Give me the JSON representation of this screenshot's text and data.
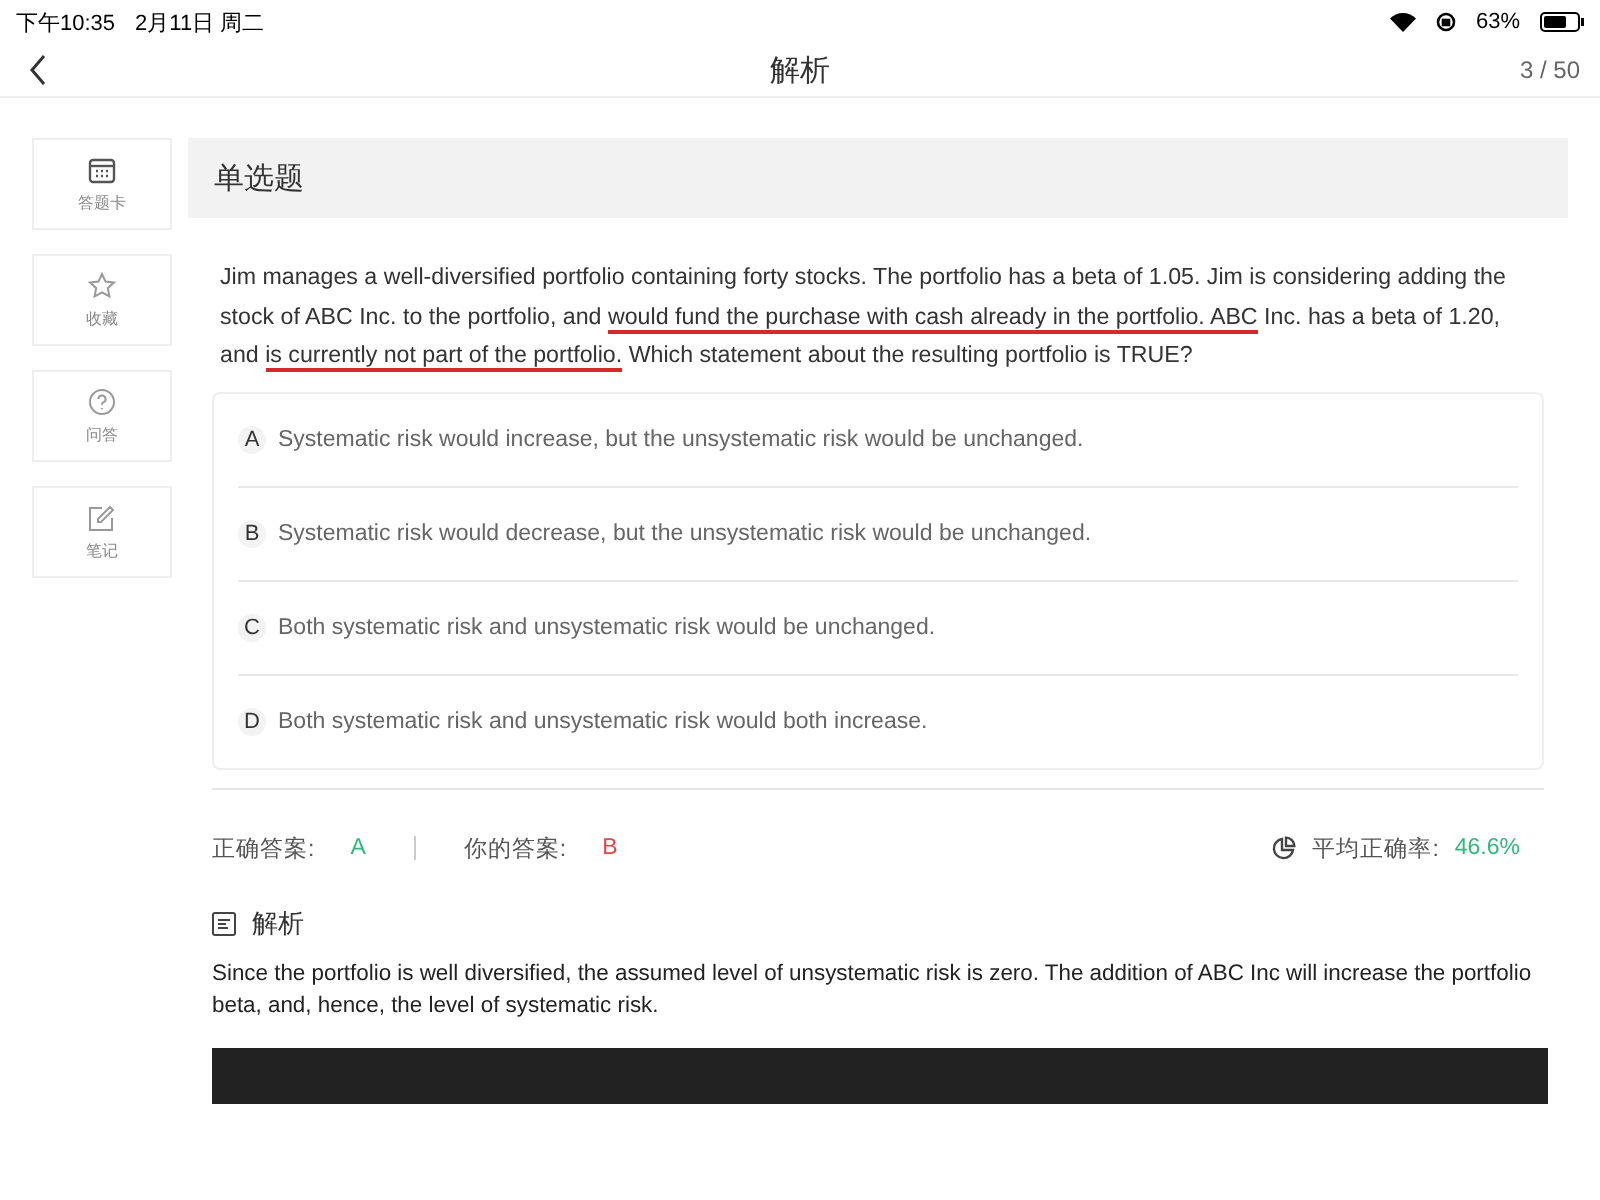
{
  "status_bar": {
    "time": "下午10:35",
    "date": "2月11日 周二",
    "battery": "63%"
  },
  "nav": {
    "title": "解析",
    "counter": "3 / 50"
  },
  "sidebar": {
    "items": [
      {
        "kind": "card",
        "label": "答题卡"
      },
      {
        "kind": "star",
        "label": "收藏"
      },
      {
        "kind": "question",
        "label": "问答"
      },
      {
        "kind": "note",
        "label": "笔记"
      }
    ]
  },
  "question": {
    "type_label": "单选题",
    "segments": [
      {
        "text": "Jim manages a well-diversified portfolio containing forty stocks. The portfolio has a beta of 1.05. Jim is considering adding the stock of ABC Inc. to the portfolio, and ",
        "marked": false
      },
      {
        "text": "would fund the purchase with cash already in the portfolio. ABC",
        "marked": true
      },
      {
        "text": " Inc. has a beta of 1.20, and ",
        "marked": false
      },
      {
        "text": "is currently not part of the portfolio.",
        "marked": true
      },
      {
        "text": " Which statement about the resulting portfolio is TRUE?",
        "marked": false
      }
    ],
    "options": [
      {
        "letter": "A",
        "text": "Systematic risk would increase, but the unsystematic risk would be unchanged."
      },
      {
        "letter": "B",
        "text": "Systematic risk would decrease, but the unsystematic risk would be unchanged."
      },
      {
        "letter": "C",
        "text": "Both systematic risk and unsystematic risk would be unchanged."
      },
      {
        "letter": "D",
        "text": "Both systematic risk and unsystematic risk would both increase."
      }
    ]
  },
  "result": {
    "correct_label": "正确答案:",
    "correct": "A",
    "yours_label": "你的答案:",
    "yours": "B",
    "average_label": "平均正确率:",
    "average": "46.6%"
  },
  "analysis": {
    "heading": "解析",
    "text": "Since the portfolio is well diversified, the assumed level of unsystematic risk is zero. The addition of ABC Inc will increase the portfolio beta, and, hence, the level of systematic risk."
  }
}
